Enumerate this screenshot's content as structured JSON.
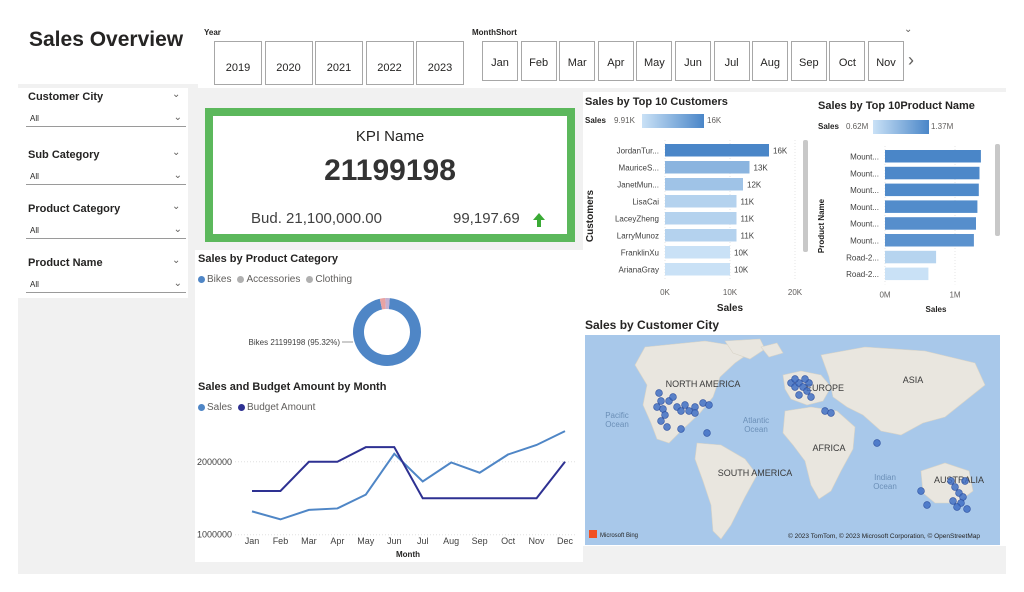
{
  "page_title": "Sales Overview",
  "year_slicer": {
    "label": "Year",
    "options": [
      "2019",
      "2020",
      "2021",
      "2022",
      "2023"
    ]
  },
  "month_slicer": {
    "label": "MonthShort",
    "options": [
      "Jan",
      "Feb",
      "Mar",
      "Apr",
      "May",
      "Jun",
      "Jul",
      "Aug",
      "Sep",
      "Oct",
      "Nov"
    ],
    "next_arrow": "›"
  },
  "slicers": [
    {
      "label": "Customer City",
      "value": "All"
    },
    {
      "label": "Sub Category",
      "value": "All"
    },
    {
      "label": "Product Category",
      "value": "All"
    },
    {
      "label": "Product Name",
      "value": "All"
    }
  ],
  "kpi": {
    "title": "KPI Name",
    "value": "21199198",
    "budget": "Bud. 21,100,000.00",
    "variance": "99,197.69",
    "trend": "up",
    "accent": "#5cb85c",
    "arrow_color": "#3aaa35"
  },
  "top_customers": {
    "title": "Sales by Top 10 Customers",
    "legend_label": "Sales",
    "legend_min": "9.91K",
    "legend_max": "16K",
    "y_axis_title": "Customers",
    "x_axis_title": "Sales",
    "x_ticks": [
      "0K",
      "10K",
      "20K"
    ]
  },
  "top_products": {
    "title": "Sales by Top 10Product Name",
    "legend_label": "Sales",
    "legend_min": "0.62M",
    "legend_max": "1.37M",
    "y_axis_title": "Product Name",
    "x_axis_title": "Sales",
    "x_ticks": [
      "0M",
      "1M"
    ]
  },
  "product_category": {
    "title": "Sales by Product Category",
    "legend": [
      {
        "name": "Bikes",
        "color": "#4f86c6"
      },
      {
        "name": "Accessories",
        "color": "#b0b0b0"
      },
      {
        "name": "Clothing",
        "color": "#b0b0b0"
      }
    ],
    "label": "Bikes 21199198 (95.32%)"
  },
  "sales_budget": {
    "title": "Sales and Budget Amount by Month",
    "legend": [
      {
        "name": "Sales",
        "color": "#4f86c6"
      },
      {
        "name": "Budget Amount",
        "color": "#2e3192"
      }
    ],
    "x_axis_title": "Month",
    "y_ticks": [
      "2000000",
      "1000000"
    ]
  },
  "map": {
    "title": "Sales by Customer City",
    "labels": {
      "north_america": "NORTH AMERICA",
      "europe": "EUROPE",
      "asia": "ASIA",
      "africa": "AFRICA",
      "south_america": "SOUTH AMERICA",
      "australia": "AUSTRALIA",
      "pacific": "Pacific\nOcean",
      "atlantic": "Atlantic\nOcean",
      "indian": "Indian\nOcean"
    },
    "attribution": "© 2023 TomTom, © 2023 Microsoft Corporation, © OpenStreetMap",
    "bing": "Microsoft Bing"
  },
  "chart_data": [
    {
      "type": "bar",
      "title": "Sales by Top 10 Customers",
      "orientation": "horizontal",
      "categories": [
        "JordanTur...",
        "MauriceS...",
        "JanetMun...",
        "LisaCai",
        "LaceyZheng",
        "LarryMunoz",
        "FranklinXu",
        "ArianaGray"
      ],
      "values": [
        16000,
        13000,
        12000,
        11000,
        11000,
        11000,
        10000,
        10000
      ],
      "data_labels": [
        "16K",
        "13K",
        "12K",
        "11K",
        "11K",
        "11K",
        "10K",
        "10K"
      ],
      "xlabel": "Sales",
      "ylabel": "Customers",
      "xlim": [
        0,
        20000
      ],
      "color_range": [
        "#c9e1f6",
        "#4a86c8"
      ]
    },
    {
      "type": "bar",
      "title": "Sales by Top 10Product Name",
      "orientation": "horizontal",
      "categories": [
        "Mount...",
        "Mount...",
        "Mount...",
        "Mount...",
        "Mount...",
        "Mount...",
        "Road-2...",
        "Road-2..."
      ],
      "values": [
        1370000,
        1350000,
        1340000,
        1320000,
        1300000,
        1270000,
        730000,
        620000
      ],
      "xlabel": "Sales",
      "ylabel": "Product Name",
      "xlim": [
        0,
        1600000
      ],
      "color_range": [
        "#c9e1f6",
        "#4a86c8"
      ]
    },
    {
      "type": "pie",
      "title": "Sales by Product Category",
      "donut": true,
      "categories": [
        "Bikes",
        "Accessories",
        "Clothing"
      ],
      "values": [
        95.32,
        2.6,
        2.08
      ],
      "colors": [
        "#4f86c6",
        "#e8a3a3",
        "#c4b2d4"
      ]
    },
    {
      "type": "line",
      "title": "Sales and Budget Amount by Month",
      "categories": [
        "Jan",
        "Feb",
        "Mar",
        "Apr",
        "May",
        "Jun",
        "Jul",
        "Aug",
        "Sep",
        "Oct",
        "Nov",
        "Dec"
      ],
      "series": [
        {
          "name": "Sales",
          "color": "#4f86c6",
          "values": [
            1320000,
            1210000,
            1340000,
            1360000,
            1550000,
            2110000,
            1730000,
            1990000,
            1850000,
            2100000,
            2230000,
            2420000
          ]
        },
        {
          "name": "Budget Amount",
          "color": "#2e3192",
          "values": [
            1600000,
            1600000,
            2000000,
            2000000,
            2200000,
            2200000,
            1500000,
            1500000,
            1500000,
            1500000,
            1500000,
            2000000
          ]
        }
      ],
      "xlabel": "Month",
      "ylim": [
        900000,
        2600000
      ],
      "y_ticks": [
        1000000,
        2000000
      ]
    }
  ]
}
